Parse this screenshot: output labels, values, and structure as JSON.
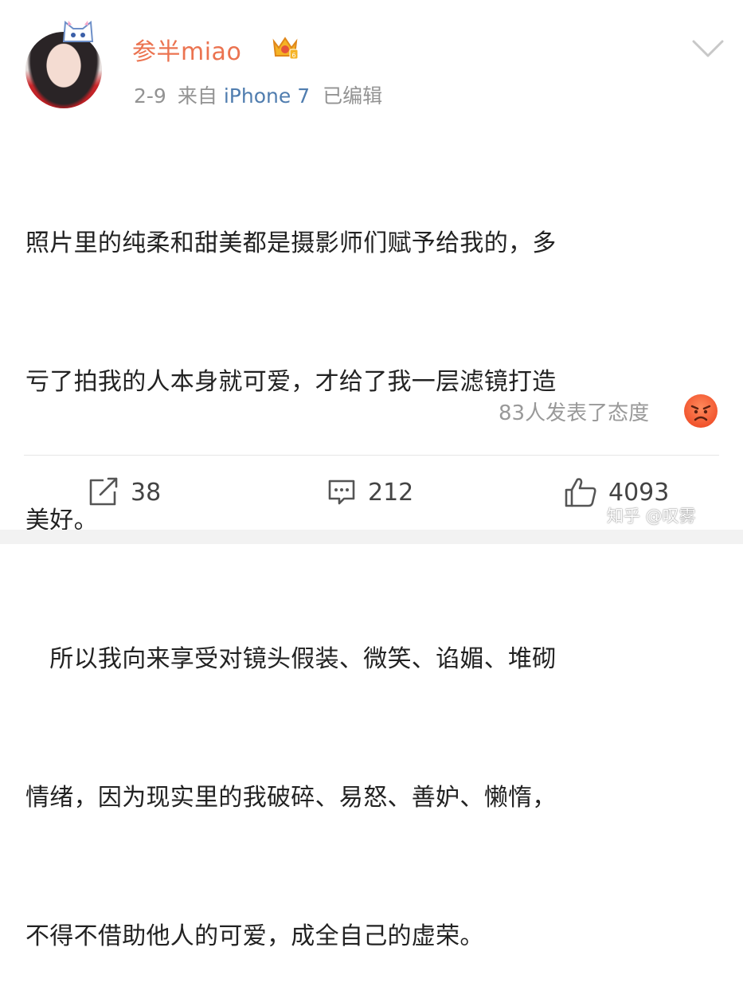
{
  "post": {
    "author": "参半miao",
    "date": "2-9",
    "source_prefix": "来自",
    "device": "iPhone 7",
    "edited": "已编辑",
    "text_lines": [
      "照片里的纯柔和甜美都是摄影师们赋予给我的，多",
      "亏了拍我的人本身就可爱，才给了我一层滤镜打造",
      "美好。",
      "　所以我向来享受对镜头假装、微笑、谄媚、堆砌",
      "情绪，因为现实里的我破碎、易怒、善妒、懒惰，",
      "不得不借助他人的可爱，成全自己的虚荣。"
    ],
    "attitude_count": "83人发表了态度"
  },
  "actions": {
    "repost_count": "38",
    "comment_count": "212",
    "like_count": "4093"
  },
  "watermark": "知乎 @叹雾",
  "colors": {
    "author": "#eb7350",
    "device_link": "#507daf",
    "meta": "#939393"
  },
  "icons": [
    "crown-badge-icon",
    "chevron-down-icon",
    "angry-face-icon",
    "repost-icon",
    "comment-icon",
    "like-icon"
  ]
}
